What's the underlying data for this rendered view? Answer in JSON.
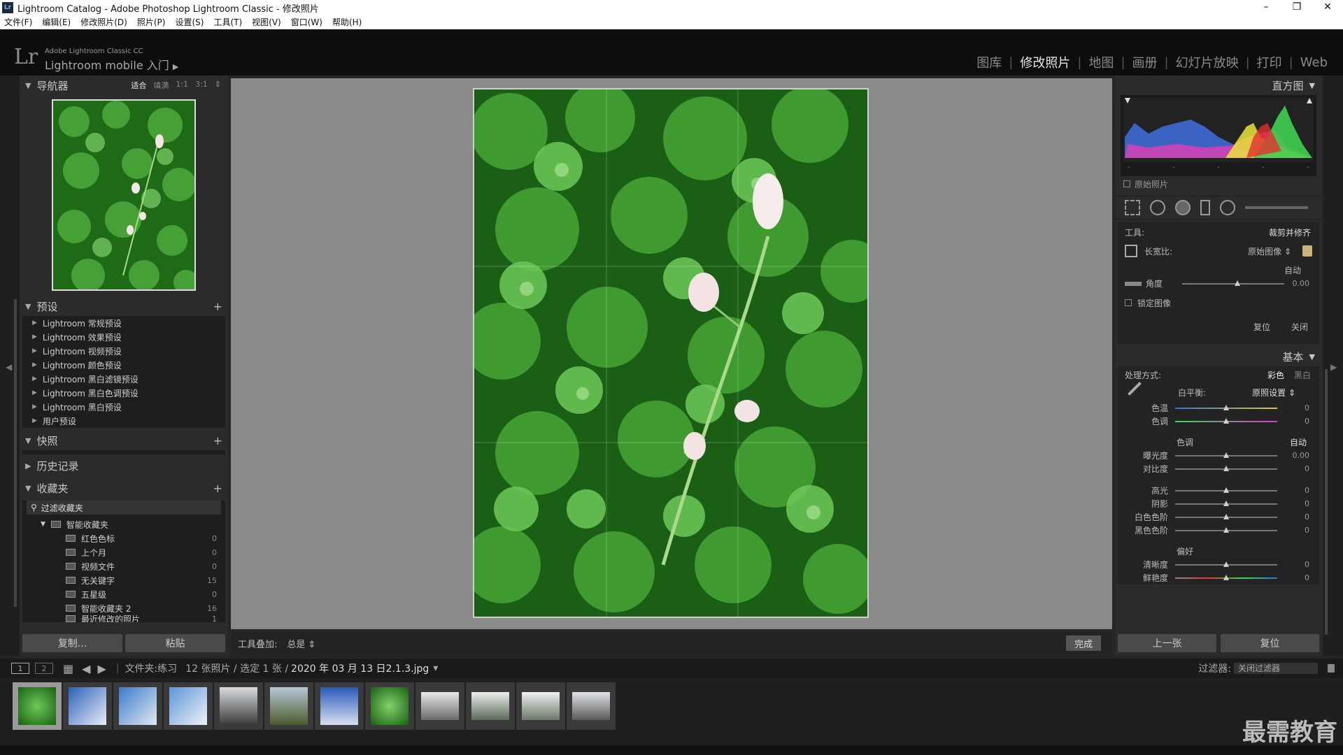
{
  "window": {
    "title": "Lightroom Catalog - Adobe Photoshop Lightroom Classic - 修改照片",
    "app_icon": "Lr",
    "controls": [
      "–",
      "❐",
      "✕"
    ]
  },
  "menu": [
    "文件(F)",
    "编辑(E)",
    "修改照片(D)",
    "照片(P)",
    "设置(S)",
    "工具(T)",
    "视图(V)",
    "窗口(W)",
    "帮助(H)"
  ],
  "identity": {
    "logo": "Lr",
    "line1": "Adobe Lightroom Classic CC",
    "line2": "Lightroom mobile 入门",
    "arrow": "▶"
  },
  "modules": [
    {
      "label": "图库",
      "active": false
    },
    {
      "label": "修改照片",
      "active": true
    },
    {
      "label": "地图",
      "active": false
    },
    {
      "label": "画册",
      "active": false
    },
    {
      "label": "幻灯片放映",
      "active": false
    },
    {
      "label": "打印",
      "active": false
    },
    {
      "label": "Web",
      "active": false
    }
  ],
  "left": {
    "navigator": {
      "title": "导航器",
      "opts": [
        "适合",
        "填满",
        "1:1",
        "3:1"
      ],
      "selected": "适合",
      "stepper": "⇕"
    },
    "presets": {
      "title": "预设",
      "items": [
        "Lightroom 常规预设",
        "Lightroom 效果预设",
        "Lightroom 视频预设",
        "Lightroom 颜色预设",
        "Lightroom 黑白滤镜预设",
        "Lightroom 黑白色调预设",
        "Lightroom 黑白预设",
        "用户预设"
      ]
    },
    "snapshots": {
      "title": "快照"
    },
    "history": {
      "title": "历史记录"
    },
    "collections": {
      "title": "收藏夹",
      "filter": "过滤收藏夹",
      "smart": "智能收藏夹",
      "items": [
        {
          "name": "红色色标",
          "count": "0"
        },
        {
          "name": "上个月",
          "count": "0"
        },
        {
          "name": "视频文件",
          "count": "0"
        },
        {
          "name": "无关键字",
          "count": "15"
        },
        {
          "name": "五星级",
          "count": "0"
        },
        {
          "name": "智能收藏夹 2",
          "count": "16"
        },
        {
          "name": "最近修改的照片",
          "count": "1"
        }
      ]
    },
    "copy_btn": "复制...",
    "paste_btn": "粘贴"
  },
  "toolbar": {
    "label": "工具叠加:",
    "value": "总是",
    "chevron": "⇕",
    "done": "完成"
  },
  "right": {
    "histogram": {
      "title": "直方图",
      "original": "原始照片",
      "ticks": [
        "-",
        "-",
        "-",
        "-",
        "-"
      ]
    },
    "tool": {
      "label": "工具:",
      "name": "裁剪并修齐",
      "aspect_label": "长宽比:",
      "aspect_value": "原始图像 ⇕",
      "auto": "自动",
      "angle_label": "角度",
      "angle_value": "0.00",
      "lock_label": "锁定图像",
      "reset": "复位",
      "close": "关闭"
    },
    "basic": {
      "title": "基本",
      "treatment_label": "处理方式:",
      "color": "彩色",
      "bw": "黑白",
      "wb_label": "白平衡:",
      "wb_value": "原照设置 ⇕",
      "temp": {
        "label": "色温",
        "value": "0",
        "level": 0.5
      },
      "tint": {
        "label": "色调",
        "value": "0",
        "level": 0.5
      },
      "tone_label": "色调",
      "tone_auto": "自动",
      "exposure": {
        "label": "曝光度",
        "value": "0.00",
        "level": 0.5
      },
      "contrast": {
        "label": "对比度",
        "value": "0",
        "level": 0.5
      },
      "highlights": {
        "label": "高光",
        "value": "0",
        "level": 0.5
      },
      "shadows": {
        "label": "阴影",
        "value": "0",
        "level": 0.5
      },
      "whites": {
        "label": "白色色阶",
        "value": "0",
        "level": 0.5
      },
      "blacks": {
        "label": "黑色色阶",
        "value": "0",
        "level": 0.5
      },
      "presence_label": "偏好",
      "clarity": {
        "label": "清晰度",
        "value": "0",
        "level": 0.5
      },
      "vibrance": {
        "label": "鲜艳度",
        "value": "0",
        "level": 0.5
      }
    },
    "prev_btn": "上一张",
    "reset_btn": "复位"
  },
  "filmbar": {
    "screen1": "1",
    "screen2": "2",
    "folder_label": "文件夹:练习",
    "info": "12 张照片 / 选定 1 张 /",
    "filename": "2020 年 03 月 13 日2.1.3.jpg",
    "chevron": "▾",
    "filter_label": "过滤器:",
    "filter_value": "关闭过滤器"
  },
  "thumbnails": [
    "clover",
    "sky",
    "sky",
    "sky",
    "tree",
    "tree",
    "clouds",
    "clover",
    "snow",
    "snow",
    "snow",
    "snow"
  ],
  "watermark": "最需教育",
  "colors": {
    "accent": "#e6e6e6",
    "panel": "#2b2b2b",
    "center": "#8a8a8a"
  }
}
